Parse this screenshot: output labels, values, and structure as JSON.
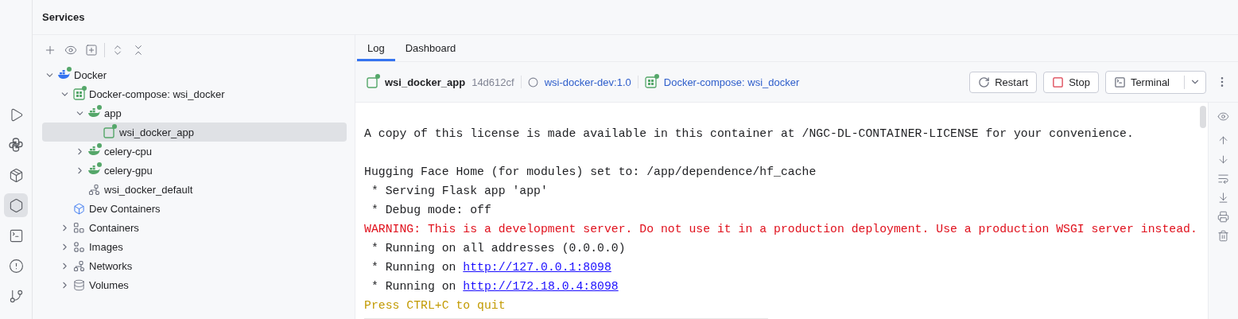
{
  "activity_bar": [
    {
      "kind": "run",
      "selected": false
    },
    {
      "kind": "python",
      "selected": false
    },
    {
      "kind": "packages",
      "selected": false
    },
    {
      "kind": "services",
      "selected": true
    },
    {
      "kind": "terminal",
      "selected": false
    },
    {
      "kind": "problems",
      "selected": false
    },
    {
      "kind": "git",
      "selected": false
    }
  ],
  "panel": {
    "title": "Services"
  },
  "tree_toolbar": [
    {
      "kind": "add"
    },
    {
      "kind": "view"
    },
    {
      "kind": "new-tab"
    },
    {
      "kind": "separator"
    },
    {
      "kind": "expand"
    },
    {
      "kind": "collapse"
    }
  ],
  "tree": [
    {
      "label": "Docker",
      "kind": "docker",
      "running": true,
      "expanded": true,
      "selected": false,
      "children": [
        {
          "label": "Docker-compose: wsi_docker",
          "kind": "compose",
          "running": true,
          "expanded": true,
          "selected": false,
          "children": [
            {
              "label": "app",
              "kind": "service",
              "running": true,
              "expanded": true,
              "selected": false,
              "children": [
                {
                  "label": "wsi_docker_app",
                  "kind": "container",
                  "running": true,
                  "selected": true
                }
              ]
            },
            {
              "label": "celery-cpu",
              "kind": "service",
              "running": true,
              "expanded": false,
              "selected": false
            },
            {
              "label": "celery-gpu",
              "kind": "service",
              "running": true,
              "expanded": false,
              "selected": false
            },
            {
              "label": "wsi_docker_default",
              "kind": "network",
              "running": false,
              "selected": false
            }
          ]
        },
        {
          "label": "Dev Containers",
          "kind": "devcontainers",
          "running": false,
          "selected": false
        },
        {
          "label": "Containers",
          "kind": "containers",
          "running": false,
          "expanded": false,
          "selected": false
        },
        {
          "label": "Images",
          "kind": "images",
          "running": false,
          "expanded": false,
          "selected": false
        },
        {
          "label": "Networks",
          "kind": "network",
          "running": false,
          "expanded": false,
          "selected": false
        },
        {
          "label": "Volumes",
          "kind": "volumes",
          "running": false,
          "expanded": false,
          "selected": false
        }
      ]
    }
  ],
  "tabs": [
    {
      "label": "Log",
      "selected": true
    },
    {
      "label": "Dashboard",
      "selected": false
    }
  ],
  "header": {
    "name": "wsi_docker_app",
    "id": "14d612cf",
    "image": "wsi-docker-dev:1.0",
    "compose": "Docker-compose: wsi_docker"
  },
  "buttons": [
    {
      "kind": "restart",
      "label": "Restart"
    },
    {
      "kind": "stop",
      "label": "Stop"
    },
    {
      "kind": "terminal",
      "label": "Terminal"
    }
  ],
  "log": [
    {
      "kind": "blank"
    },
    {
      "kind": "text",
      "text": "A copy of this license is made available in this container at /NGC-DL-CONTAINER-LICENSE for your convenience."
    },
    {
      "kind": "blank"
    },
    {
      "kind": "text",
      "text": "Hugging Face Home (for modules) set to: /app/dependence/hf_cache"
    },
    {
      "kind": "text",
      "text": " * Serving Flask app 'app'"
    },
    {
      "kind": "text",
      "text": " * Debug mode: off"
    },
    {
      "kind": "warning",
      "text": "WARNING: This is a development server. Do not use it in a production deployment. Use a production WSGI server instead."
    },
    {
      "kind": "text",
      "text": " * Running on all addresses (0.0.0.0)"
    },
    {
      "kind": "link",
      "text": " * Running on ",
      "link": "http://127.0.0.1:8098"
    },
    {
      "kind": "link",
      "text": " * Running on ",
      "link": "http://172.18.0.4:8098"
    },
    {
      "kind": "info",
      "text": "Press CTRL+C to quit"
    },
    {
      "kind": "input"
    }
  ],
  "log_toolbar": [
    {
      "kind": "view"
    },
    {
      "kind": "up"
    },
    {
      "kind": "down"
    },
    {
      "kind": "wrap"
    },
    {
      "kind": "scroll-end"
    },
    {
      "kind": "print"
    },
    {
      "kind": "clear"
    }
  ]
}
